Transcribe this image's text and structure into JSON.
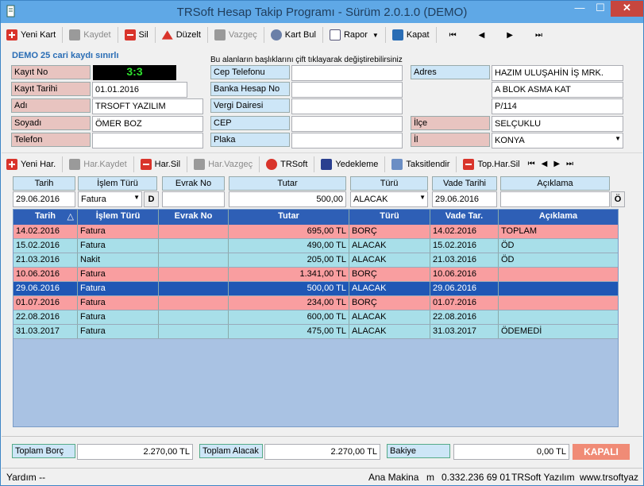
{
  "window": {
    "title": "TRSoft Hesap Takip Programı - Sürüm 2.0.1.0 (DEMO)",
    "min": "—",
    "max": "☐",
    "close": "✕"
  },
  "toolbar1": {
    "new": "Yeni Kart",
    "save": "Kaydet",
    "delete": "Sil",
    "edit": "Düzelt",
    "cancel": "Vazgeç",
    "find": "Kart Bul",
    "report": "Rapor",
    "close": "Kapat",
    "first": "⏮",
    "prev": "◀",
    "next": "▶",
    "last": "⏭"
  },
  "notice": "DEMO 25 cari kaydı sınırlı",
  "hint": "Bu alanların başlıklarını çift tıklayarak değiştirebilirsiniz",
  "card": {
    "kayit_no_label": "Kayıt No",
    "kayit_no": "3:3",
    "kayit_tarihi_label": "Kayıt Tarihi",
    "kayit_tarihi": "01.01.2016",
    "adi_label": "Adı",
    "adi": "TRSOFT YAZILIM",
    "soyadi_label": "Soyadı",
    "soyadi": "ÖMER BOZ",
    "telefon_label": "Telefon",
    "telefon": "",
    "cep_tel_label": "Cep Telefonu",
    "cep_tel": "",
    "banka_label": "Banka Hesap No",
    "banka": "",
    "vergi_label": "Vergi Dairesi",
    "vergi": "",
    "cep_label": "CEP",
    "cep": "",
    "plaka_label": "Plaka",
    "plaka": "",
    "adres_label": "Adres",
    "adres1": "HAZIM ULUŞAHİN İŞ MRK.",
    "adres2": "A BLOK ASMA KAT",
    "adres3": "P/114",
    "ilce_label": "İlçe",
    "ilce": "SELÇUKLU",
    "il_label": "İl",
    "il": "KONYA"
  },
  "toolbar2": {
    "new": "Yeni Har.",
    "save": "Har.Kaydet",
    "delete": "Har.Sil",
    "cancel": "Har.Vazgeç",
    "trsoft": "TRSoft",
    "backup": "Yedekleme",
    "install": "Taksitlendir",
    "delall": "Top.Har.Sil",
    "first": "⏮",
    "prev": "◀",
    "next": "▶",
    "last": "⏭"
  },
  "entry": {
    "h_tarih": "Tarih",
    "h_islem": "İşlem Türü",
    "h_evrak": "Evrak No",
    "h_tutar": "Tutar",
    "h_turu": "Türü",
    "h_vade": "Vade Tarihi",
    "h_aciklama": "Açıklama",
    "tarih": "29.06.2016",
    "islem": "Fatura",
    "d_btn": "D",
    "evrak": "",
    "tutar": "500,00",
    "turu": "ALACAK",
    "vade": "29.06.2016",
    "aciklama": "",
    "o_btn": "Ö"
  },
  "grid": {
    "headers": [
      "Tarih",
      "İşlem Türü",
      "Evrak No",
      "Tutar",
      "Türü",
      "Vade Tar.",
      "Açıklama"
    ],
    "sort_icon": "△",
    "rows": [
      {
        "tarih": "14.02.2016",
        "islem": "Fatura",
        "evrak": "",
        "tutar": "695,00 TL",
        "turu": "BORÇ",
        "vade": "14.02.2016",
        "aciklama": "TOPLAM",
        "style": "rp"
      },
      {
        "tarih": "15.02.2016",
        "islem": "Fatura",
        "evrak": "",
        "tutar": "490,00 TL",
        "turu": "ALACAK",
        "vade": "15.02.2016",
        "aciklama": "ÖD",
        "style": "rb"
      },
      {
        "tarih": "21.03.2016",
        "islem": "Nakit",
        "evrak": "",
        "tutar": "205,00 TL",
        "turu": "ALACAK",
        "vade": "21.03.2016",
        "aciklama": "ÖD",
        "style": "rb"
      },
      {
        "tarih": "10.06.2016",
        "islem": "Fatura",
        "evrak": "",
        "tutar": "1.341,00 TL",
        "turu": "BORÇ",
        "vade": "10.06.2016",
        "aciklama": "",
        "style": "rp"
      },
      {
        "tarih": "29.06.2016",
        "islem": "Fatura",
        "evrak": "",
        "tutar": "500,00 TL",
        "turu": "ALACAK",
        "vade": "29.06.2016",
        "aciklama": "",
        "style": "rs"
      },
      {
        "tarih": "01.07.2016",
        "islem": "Fatura",
        "evrak": "",
        "tutar": "234,00 TL",
        "turu": "BORÇ",
        "vade": "01.07.2016",
        "aciklama": "",
        "style": "rp"
      },
      {
        "tarih": "22.08.2016",
        "islem": "Fatura",
        "evrak": "",
        "tutar": "600,00 TL",
        "turu": "ALACAK",
        "vade": "22.08.2016",
        "aciklama": "",
        "style": "rb"
      },
      {
        "tarih": "31.03.2017",
        "islem": "Fatura",
        "evrak": "",
        "tutar": "475,00 TL",
        "turu": "ALACAK",
        "vade": "31.03.2017",
        "aciklama": "ÖDEMEDİ",
        "style": "rb"
      }
    ]
  },
  "totals": {
    "borc_label": "Toplam Borç",
    "borc": "2.270,00 TL",
    "alacak_label": "Toplam Alacak",
    "alacak": "2.270,00 TL",
    "bakiye_label": "Bakiye",
    "bakiye": "0,00 TL",
    "status": "KAPALI"
  },
  "status": {
    "help": "Yardım --",
    "machine": "Ana Makina",
    "m": "m",
    "phone": "0.332.236 69 01",
    "company": "TRSoft Yazılım",
    "web": "www.trsoftyaz"
  },
  "colors": {
    "title": "#5fa8e6",
    "accent": "#2e5fb6",
    "borc_row": "#f99ea0",
    "alacak_row": "#a8dfe9",
    "selected_row": "#1f57b5"
  }
}
